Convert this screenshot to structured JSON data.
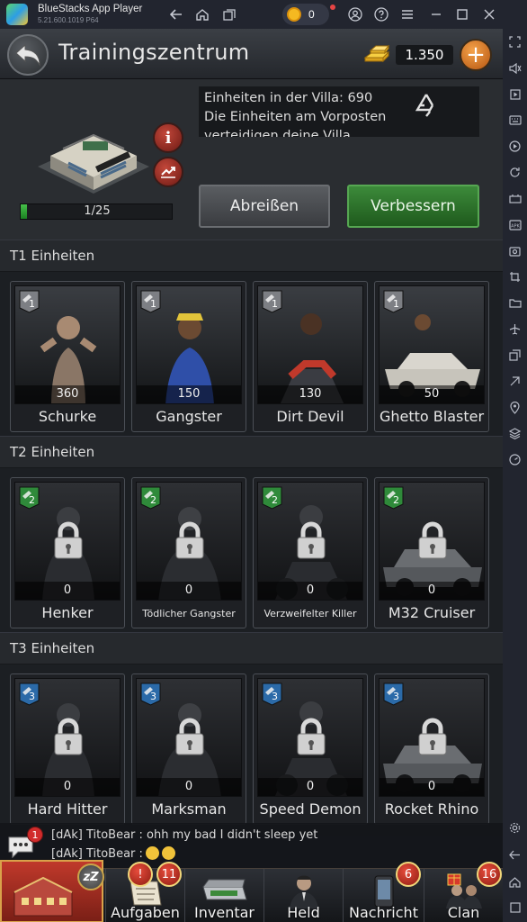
{
  "window": {
    "app_title": "BlueStacks App Player",
    "version": "5.21.600.1019  P64",
    "coin_count": "0"
  },
  "header": {
    "title": "Trainingszentrum",
    "gold_amount": "1.350"
  },
  "building": {
    "info_lines": [
      "Einheiten in der Villa: 690",
      "Die Einheiten am Vorposten",
      "verteidigen deine Villa"
    ],
    "progress_label": "1/25",
    "progress_fraction": 0.04,
    "demolish_label": "Abreißen",
    "upgrade_label": "Verbessern"
  },
  "sections": [
    {
      "title": "T1 Einheiten",
      "units": [
        {
          "tier": "1",
          "count": "360",
          "name": "Schurke",
          "locked": false
        },
        {
          "tier": "1",
          "count": "150",
          "name": "Gangster",
          "locked": false
        },
        {
          "tier": "1",
          "count": "130",
          "name": "Dirt Devil",
          "locked": false
        },
        {
          "tier": "1",
          "count": "50",
          "name": "Ghetto Blaster",
          "locked": false
        }
      ]
    },
    {
      "title": "T2 Einheiten",
      "units": [
        {
          "tier": "2",
          "count": "0",
          "name": "Henker",
          "locked": true
        },
        {
          "tier": "2",
          "count": "0",
          "name": "Tödlicher Gangster",
          "locked": true
        },
        {
          "tier": "2",
          "count": "0",
          "name": "Verzweifelter Killer",
          "locked": true
        },
        {
          "tier": "2",
          "count": "0",
          "name": "M32 Cruiser",
          "locked": true
        }
      ]
    },
    {
      "title": "T3 Einheiten",
      "units": [
        {
          "tier": "3",
          "count": "0",
          "name": "Hard Hitter",
          "locked": true
        },
        {
          "tier": "3",
          "count": "0",
          "name": "Marksman",
          "locked": true
        },
        {
          "tier": "3",
          "count": "0",
          "name": "Speed Demon",
          "locked": true
        },
        {
          "tier": "3",
          "count": "0",
          "name": "Rocket Rhino",
          "locked": true
        }
      ]
    }
  ],
  "chat": {
    "badge": "1",
    "line1": "[dAk] TitoBear : ohh my bad I didn't sleep yet",
    "line2": "[dAk] TitoBear :"
  },
  "nav": {
    "zz": "zZ",
    "aufgaben": {
      "label": "Aufgaben",
      "badge": "11"
    },
    "inventar": {
      "label": "Inventar"
    },
    "held": {
      "label": "Held"
    },
    "nachricht": {
      "label": "Nachricht",
      "badge": "6"
    },
    "clan": {
      "label": "Clan",
      "badge": "16"
    }
  },
  "colors": {
    "upgrade_green": "#2e7a2b",
    "progress_green": "#3fb544",
    "badge_red": "#d12b2b",
    "tier1_badge": "#7d7f84",
    "tier2_badge": "#2f8a3a",
    "tier3_badge": "#2b6aa8"
  }
}
